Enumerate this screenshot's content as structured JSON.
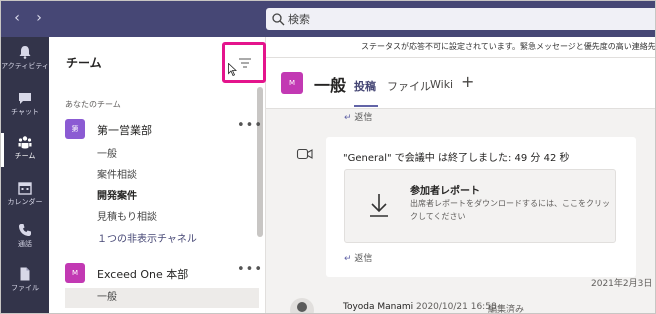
{
  "topbar": {
    "search_placeholder": "検索"
  },
  "rail": {
    "items": [
      {
        "label": "アクティビティ",
        "icon": "bell-icon"
      },
      {
        "label": "チャット",
        "icon": "chat-icon"
      },
      {
        "label": "チーム",
        "icon": "teams-icon",
        "active": true
      },
      {
        "label": "カレンダー",
        "icon": "calendar-icon"
      },
      {
        "label": "通話",
        "icon": "phone-icon"
      },
      {
        "label": "ファイル",
        "icon": "file-icon"
      }
    ]
  },
  "panel": {
    "title": "チーム",
    "section_label": "あなたのチーム",
    "teams": [
      {
        "avatar": "第",
        "name": "第一営業部",
        "more": "•••",
        "channels": [
          "一般",
          "案件相談",
          "開発案件",
          "見積もり相談",
          "１つの非表示チャネル"
        ]
      },
      {
        "avatar": "M",
        "name": "Exceed One 本部",
        "more": "•••",
        "channels": [
          "一般"
        ]
      }
    ]
  },
  "main": {
    "banner": "ステータスが応答不可に設定されています。緊急メッセージと優先度の高い連絡先か",
    "channel": {
      "avatar": "M",
      "title": "一般",
      "tabs": [
        "投稿",
        "ファイル",
        "Wiki"
      ],
      "add_tab": "+"
    },
    "reply_label": "返信",
    "meeting": {
      "text": "\"General\" で会議中 は終了しました: 49 分 42 秒"
    },
    "attendance": {
      "title": "参加者レポート",
      "desc": "出席者レポートをダウンロードするには、ここをクリックしてください"
    },
    "date_separator": "2021年2月3日",
    "message": {
      "author": "Toyoda Manami",
      "date": "2020/10/21 16:58",
      "edited": "編集済み"
    }
  },
  "colors": {
    "accent": "#6264a7",
    "highlight_border": "#e4148c",
    "rail_bg": "#33344a",
    "topbar_bg": "#464775"
  }
}
